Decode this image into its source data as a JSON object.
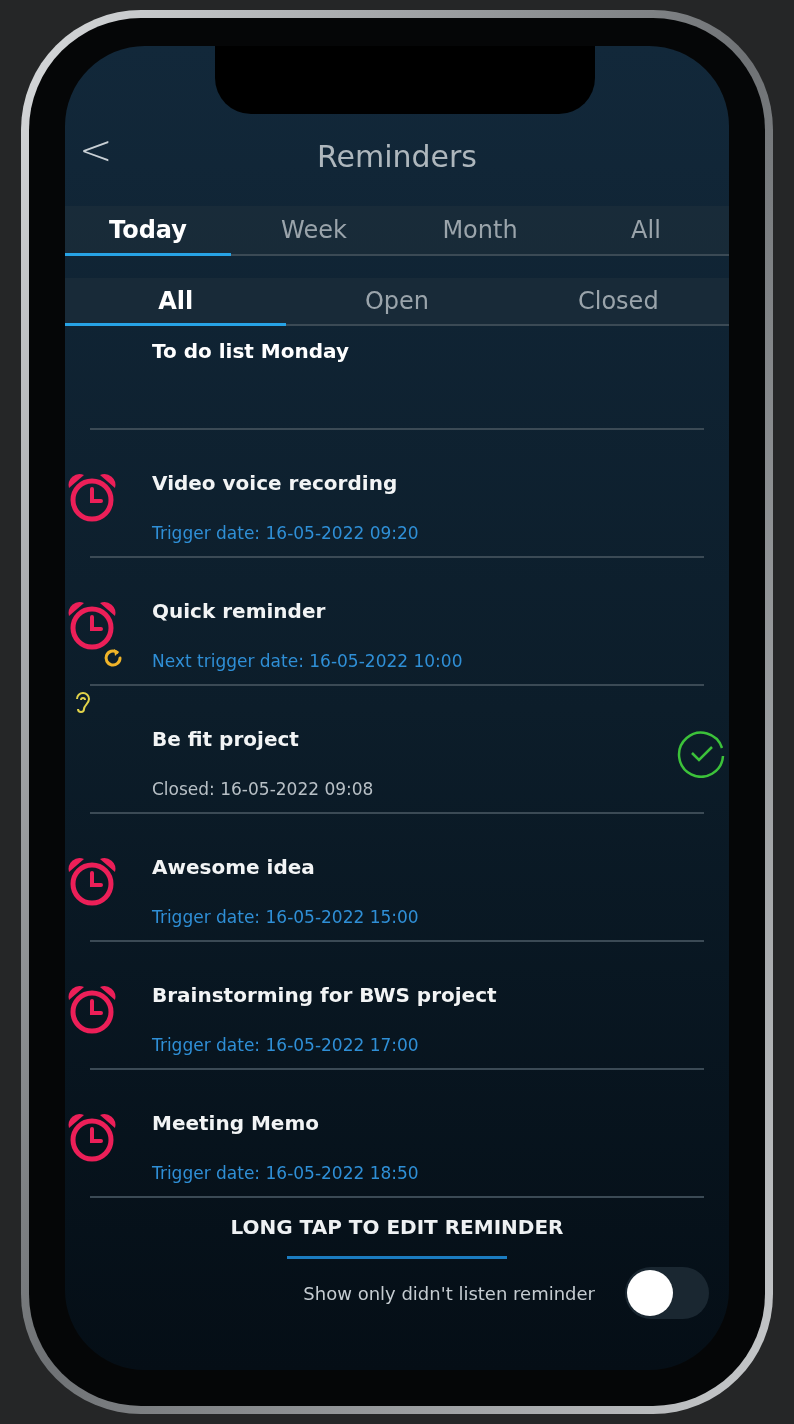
{
  "header": {
    "back": "<",
    "title": "Reminders"
  },
  "period_tabs": [
    {
      "label": "Today",
      "selected": true
    },
    {
      "label": "Week",
      "selected": false
    },
    {
      "label": "Month",
      "selected": false
    },
    {
      "label": "All",
      "selected": false
    }
  ],
  "status_tabs": [
    {
      "label": "All",
      "selected": true
    },
    {
      "label": "Open",
      "selected": false
    },
    {
      "label": "Closed",
      "selected": false
    }
  ],
  "reminders": [
    {
      "kind": "partial",
      "title": "To do list Monday"
    },
    {
      "kind": "alarm",
      "title": "Video voice recording",
      "detail": "Trigger date: 16-05-2022 09:20"
    },
    {
      "kind": "repeat",
      "title": "Quick reminder",
      "detail": "Next trigger date: 16-05-2022 10:00"
    },
    {
      "kind": "closed",
      "title": "Be fit project",
      "detail": "Closed: 16-05-2022 09:08"
    },
    {
      "kind": "alarm",
      "title": "Awesome idea",
      "detail": "Trigger date: 16-05-2022 15:00"
    },
    {
      "kind": "alarm",
      "title": "Brainstorming for BWS project",
      "detail": "Trigger date: 16-05-2022 17:00"
    },
    {
      "kind": "alarm",
      "title": "Meeting Memo",
      "detail": "Trigger date: 16-05-2022 18:50"
    }
  ],
  "footer": {
    "hint": "LONG TAP TO EDIT REMINDER",
    "toggle_label": "Show only didn't listen reminder",
    "toggle_on": false
  }
}
